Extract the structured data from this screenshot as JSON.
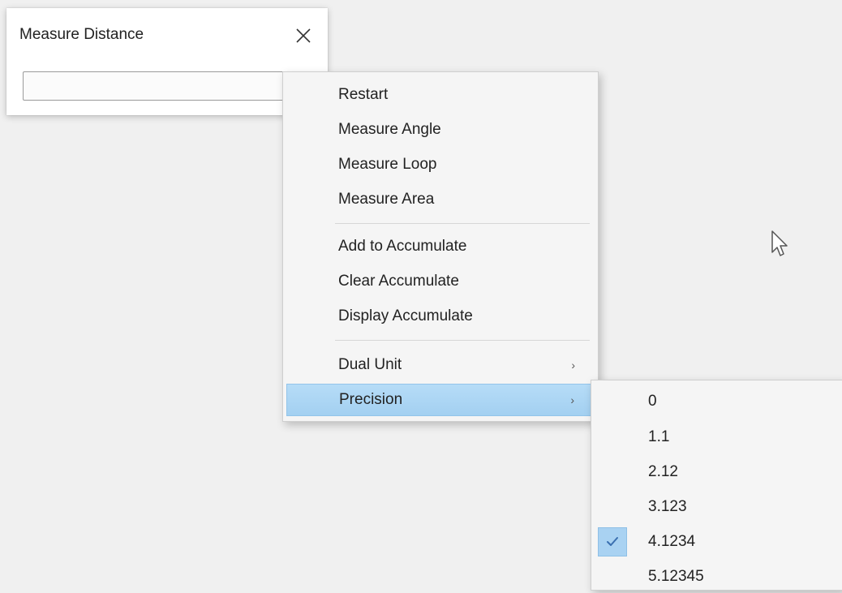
{
  "dialog": {
    "title": "Measure Distance",
    "input_value": ""
  },
  "context_menu": {
    "items": [
      {
        "label": "Restart"
      },
      {
        "label": "Measure Angle"
      },
      {
        "label": "Measure Loop"
      },
      {
        "label": "Measure Area"
      },
      {
        "label": "Add to Accumulate"
      },
      {
        "label": "Clear Accumulate"
      },
      {
        "label": "Display Accumulate"
      },
      {
        "label": "Dual Unit",
        "has_submenu": true
      },
      {
        "label": "Precision",
        "has_submenu": true,
        "highlighted": true
      }
    ],
    "submenu_arrow": "›"
  },
  "precision_submenu": {
    "items": [
      {
        "label": "0"
      },
      {
        "label": "1.1"
      },
      {
        "label": "2.12"
      },
      {
        "label": "3.123"
      },
      {
        "label": "4.1234",
        "checked": true
      },
      {
        "label": "5.12345"
      }
    ]
  },
  "colors": {
    "highlight": "#a9d2f2",
    "menu_bg": "#f5f5f5",
    "desktop_bg": "#f0f0f0"
  },
  "icons": {
    "close": "close-icon",
    "check": "checkmark-icon",
    "arrow": "chevron-right-icon",
    "pointer": "mouse-pointer-icon"
  }
}
